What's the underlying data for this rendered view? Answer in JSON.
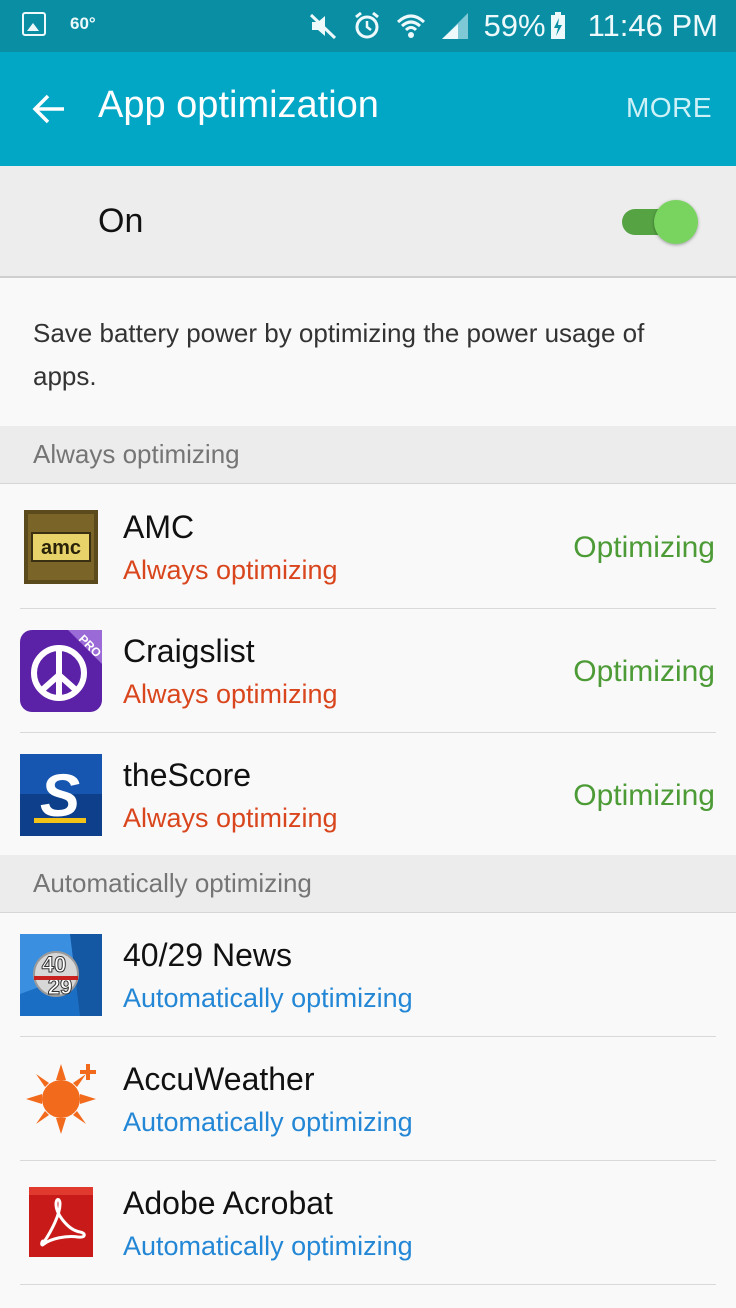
{
  "status_bar": {
    "temperature": "60°",
    "battery": "59%",
    "time": "11:46 PM"
  },
  "app_bar": {
    "title": "App optimization",
    "more_label": "MORE"
  },
  "master_switch": {
    "label": "On",
    "on": true
  },
  "description": "Save battery power by optimizing the power usage of apps.",
  "sections": [
    {
      "header": "Always optimizing",
      "apps": [
        {
          "name": "AMC",
          "subtitle": "Always optimizing",
          "status": "Optimizing",
          "icon": "amc-icon"
        },
        {
          "name": "Craigslist",
          "subtitle": "Always optimizing",
          "status": "Optimizing",
          "icon": "craigslist-icon"
        },
        {
          "name": "theScore",
          "subtitle": "Always optimizing",
          "status": "Optimizing",
          "icon": "thescore-icon"
        }
      ]
    },
    {
      "header": "Automatically optimizing",
      "apps": [
        {
          "name": "40/29 News",
          "subtitle": "Automatically optimizing",
          "status": "",
          "icon": "4029-news-icon"
        },
        {
          "name": "AccuWeather",
          "subtitle": "Automatically optimizing",
          "status": "",
          "icon": "accuweather-icon"
        },
        {
          "name": "Adobe Acrobat",
          "subtitle": "Automatically optimizing",
          "status": "",
          "icon": "adobe-acrobat-icon"
        }
      ]
    }
  ],
  "colors": {
    "status_bar": "#0a8ea4",
    "app_bar": "#02a7c6",
    "always_text": "#d9461d",
    "auto_text": "#2387d6",
    "optimizing_text": "#4d9b36",
    "switch_on": "#78d45e"
  }
}
